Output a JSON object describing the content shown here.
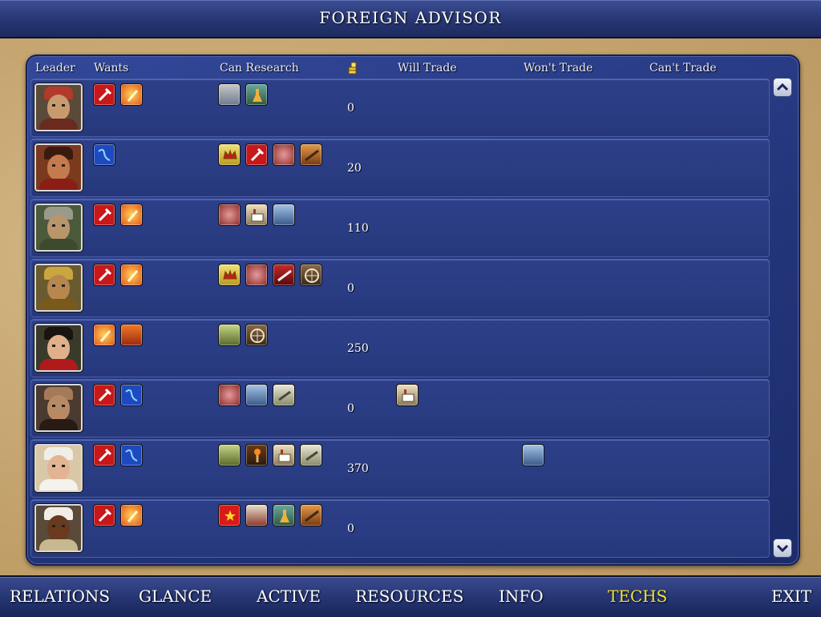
{
  "window": {
    "title": "FOREIGN ADVISOR"
  },
  "columns": {
    "leader": "Leader",
    "wants": "Wants",
    "can_research": "Can Research",
    "will_trade": "Will Trade",
    "wont_trade": "Won't Trade",
    "cant_trade": "Can't Trade"
  },
  "rows": [
    {
      "leader_icon": "bearded-king-portrait",
      "gold": "0"
    },
    {
      "leader_icon": "mustached-warrior-portrait",
      "gold": "20"
    },
    {
      "leader_icon": "horned-helmet-viking-portrait",
      "gold": "110"
    },
    {
      "leader_icon": "golden-crown-monarch-portrait",
      "gold": "0"
    },
    {
      "leader_icon": "dark-haired-queen-portrait",
      "gold": "250"
    },
    {
      "leader_icon": "bald-emperor-portrait",
      "gold": "0"
    },
    {
      "leader_icon": "veiled-queen-portrait",
      "gold": "370"
    },
    {
      "leader_icon": "turbaned-king-portrait",
      "gold": "0"
    }
  ],
  "nav": {
    "relations": "RELATIONS",
    "glance": "GLANCE",
    "active": "ACTIVE",
    "resources": "RESOURCES",
    "info": "INFO",
    "techs": "TECHS",
    "exit": "EXIT"
  },
  "active_tab": "TECHS",
  "colors": {
    "accent_active": "#f2e23a",
    "panel_blue": "#2a3c82",
    "parchment": "#c8a873"
  }
}
